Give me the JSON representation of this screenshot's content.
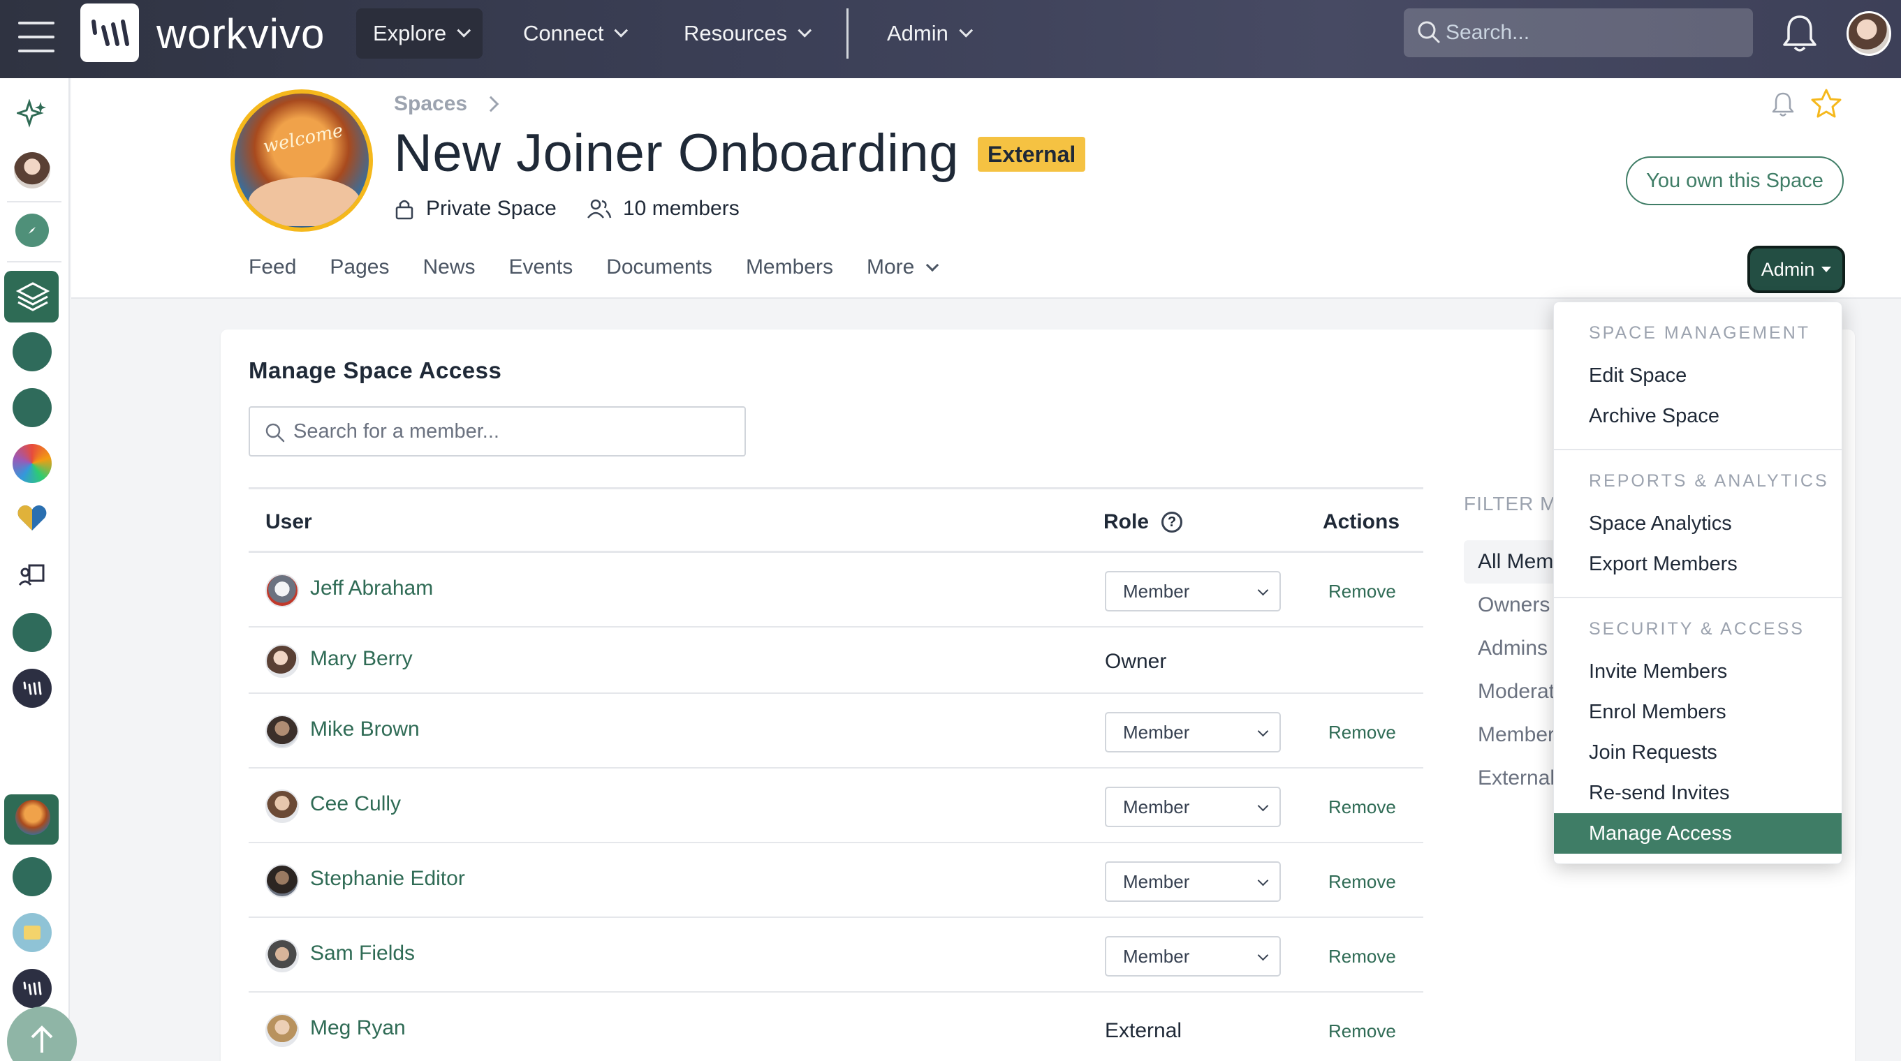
{
  "topnav": {
    "brand": "workvivo",
    "items": [
      {
        "label": "Explore"
      },
      {
        "label": "Connect"
      },
      {
        "label": "Resources"
      },
      {
        "label": "Admin"
      }
    ],
    "search_placeholder": "Search..."
  },
  "space": {
    "breadcrumb": "Spaces",
    "title": "New Joiner Onboarding",
    "badge": "External",
    "privacy": "Private Space",
    "members": "10 members",
    "own_button": "You own this Space",
    "admin_button": "Admin",
    "tabs": [
      {
        "label": "Feed"
      },
      {
        "label": "Pages"
      },
      {
        "label": "News"
      },
      {
        "label": "Events"
      },
      {
        "label": "Documents"
      },
      {
        "label": "Members"
      },
      {
        "label": "More"
      }
    ],
    "avatar_text": "welcome"
  },
  "card": {
    "title": "Manage Space Access",
    "search_placeholder": "Search for a member...",
    "columns": {
      "user": "User",
      "role": "Role",
      "actions": "Actions"
    },
    "rows": [
      {
        "name": "Jeff Abraham",
        "role": "Member",
        "editable": true,
        "action": "Remove"
      },
      {
        "name": "Mary Berry",
        "role": "Owner",
        "editable": false,
        "action": ""
      },
      {
        "name": "Mike Brown",
        "role": "Member",
        "editable": true,
        "action": "Remove"
      },
      {
        "name": "Cee Cully",
        "role": "Member",
        "editable": true,
        "action": "Remove"
      },
      {
        "name": "Stephanie Editor",
        "role": "Member",
        "editable": true,
        "action": "Remove"
      },
      {
        "name": "Sam Fields",
        "role": "Member",
        "editable": true,
        "action": "Remove"
      },
      {
        "name": "Meg Ryan",
        "role": "External",
        "editable": false,
        "action": "Remove"
      }
    ],
    "filter": {
      "label": "FILTER ME",
      "items": [
        "All Mem",
        "Owners",
        "Admins",
        "Moderat",
        "Member",
        "External"
      ]
    }
  },
  "dropdown": {
    "sections": [
      {
        "heading": "SPACE MANAGEMENT",
        "items": [
          "Edit Space",
          "Archive Space"
        ]
      },
      {
        "heading": "REPORTS & ANALYTICS",
        "items": [
          "Space Analytics",
          "Export Members"
        ]
      },
      {
        "heading": "SECURITY & ACCESS",
        "items": [
          "Invite Members",
          "Enrol Members",
          "Join Requests",
          "Re-send Invites",
          "Manage Access"
        ]
      }
    ],
    "active_item": "Manage Access"
  },
  "colors": {
    "brand_green": "#3f7d66",
    "nav_bg": "#3b3f56",
    "badge_yellow": "#f5c242"
  }
}
